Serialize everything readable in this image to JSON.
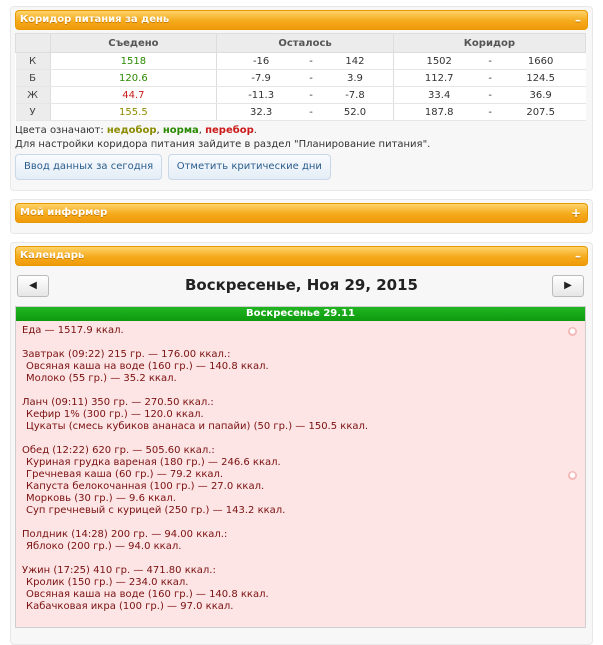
{
  "corridor": {
    "title": "Коридор питания за день",
    "toggle": "–",
    "columns": [
      "Съедено",
      "Осталось",
      "Коридор"
    ],
    "rows": [
      {
        "label": "К",
        "eaten": "1518",
        "rem_min": "-16",
        "rem_max": "142",
        "cor_min": "1502",
        "cor_max": "1660",
        "color": "green"
      },
      {
        "label": "Б",
        "eaten": "120.6",
        "rem_min": "-7.9",
        "rem_max": "3.9",
        "cor_min": "112.7",
        "cor_max": "124.5",
        "color": "green"
      },
      {
        "label": "Ж",
        "eaten": "44.7",
        "rem_min": "-11.3",
        "rem_max": "-7.8",
        "cor_min": "33.4",
        "cor_max": "36.9",
        "color": "red"
      },
      {
        "label": "У",
        "eaten": "155.5",
        "rem_min": "32.3",
        "rem_max": "52.0",
        "cor_min": "187.8",
        "cor_max": "207.5",
        "color": "olive"
      }
    ],
    "dash": "-",
    "legend_prefix": "Цвета означают: ",
    "legend_under": "недобор",
    "legend_norm": "норма",
    "legend_over": "перебор",
    "legend_suffix": ".",
    "hint": "Для настройки коридора питания зайдите в раздел \"Планирование питания\".",
    "btn_input": "Ввод данных за сегодня",
    "btn_critical": "Отметить критические дни"
  },
  "informer": {
    "title": "Мой информер",
    "toggle": "+"
  },
  "calendar": {
    "title": "Календарь",
    "toggle": "–",
    "prev": "◀",
    "next": "▶",
    "date_title": "Воскресенье, Ноя 29, 2015",
    "day_header": "Воскресенье 29.11",
    "total": "Еда — 1517.9 ккал.",
    "meals": [
      {
        "title": "Завтрак (09:22) 215 гр. — 176.00 ккал.:",
        "items": [
          "Овсяная каша на воде (160 гр.) — 140.8 ккал.",
          "Молоко (55 гр.) — 35.2 ккал."
        ]
      },
      {
        "title": "Ланч (09:11) 350 гр. — 270.50 ккал.:",
        "items": [
          "Кефир 1% (300 гр.) — 120.0 ккал.",
          "Цукаты (смесь кубиков ананаса и папайи) (50 гр.) — 150.5 ккал."
        ]
      },
      {
        "title": "Обед (12:22) 620 гр. — 505.60 ккал.:",
        "items": [
          "Куриная грудка вареная (180 гр.) — 246.6 ккал.",
          "Гречневая каша (60 гр.) — 79.2 ккал.",
          "Капуста белокочанная (100 гр.) — 27.0 ккал.",
          "Морковь (30 гр.) — 9.6 ккал.",
          "Суп гречневый с курицей (250 гр.) — 143.2 ккал."
        ]
      },
      {
        "title": "Полдник (14:28) 200 гр. — 94.00 ккал.:",
        "items": [
          "Яблоко (200 гр.) — 94.0 ккал."
        ]
      },
      {
        "title": "Ужин (17:25) 410 гр. — 471.80 ккал.:",
        "items": [
          "Кролик (150 гр.) — 234.0 ккал.",
          "Овсяная каша на воде (160 гр.) — 140.8 ккал.",
          "Кабачковая икра (100 гр.) — 97.0 ккал."
        ]
      }
    ]
  }
}
